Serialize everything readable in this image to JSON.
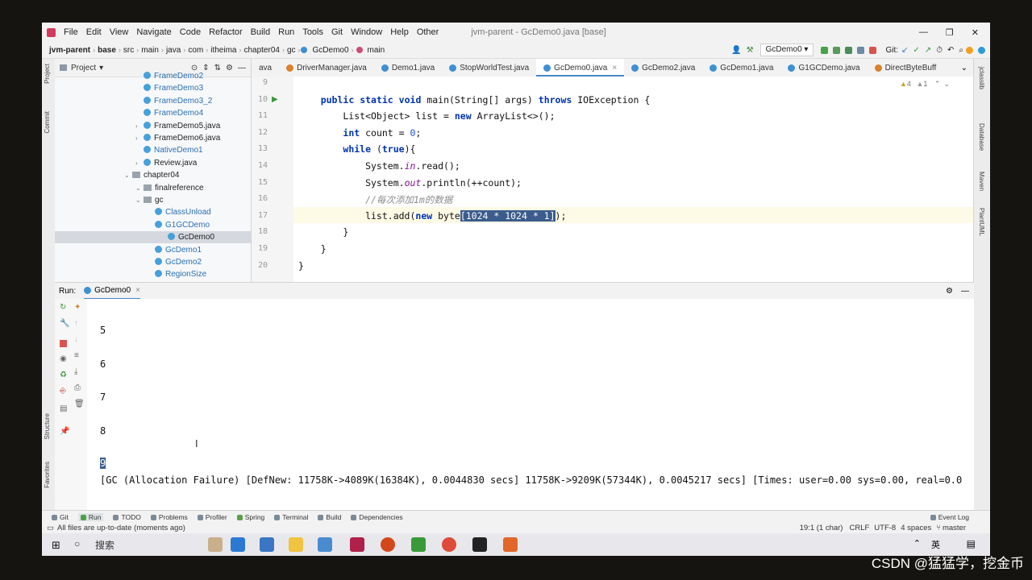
{
  "menu": {
    "items": [
      "File",
      "Edit",
      "View",
      "Navigate",
      "Code",
      "Refactor",
      "Build",
      "Run",
      "Tools",
      "Git",
      "Window",
      "Help",
      "Other"
    ],
    "title": "jvm-parent - GcDemo0.java [base]"
  },
  "breadcrumb": [
    "jvm-parent",
    "base",
    "src",
    "main",
    "java",
    "com",
    "itheima",
    "chapter04",
    "gc",
    "GcDemo0",
    "main"
  ],
  "toolbar": {
    "run_config": "GcDemo0",
    "git_label": "Git:"
  },
  "tabs": [
    "ava",
    "DriverManager.java",
    "Demo1.java",
    "StopWorldTest.java",
    "GcDemo0.java",
    "GcDemo2.java",
    "GcDemo1.java",
    "G1GCDemo.java",
    "DirectByteBuff"
  ],
  "active_tab": "GcDemo0.java",
  "inspections": {
    "warnings": "4",
    "weak": "1"
  },
  "project": {
    "label": "Project",
    "tree": [
      {
        "label": "FrameDemo2",
        "kind": "class",
        "indent": 0
      },
      {
        "label": "FrameDemo3",
        "kind": "class",
        "indent": 0
      },
      {
        "label": "FrameDemo3_2",
        "kind": "class",
        "indent": 0
      },
      {
        "label": "FrameDemo4",
        "kind": "class",
        "indent": 0
      },
      {
        "label": "FrameDemo5.java",
        "kind": "file",
        "indent": 0,
        "arrow": true
      },
      {
        "label": "FrameDemo6.java",
        "kind": "file",
        "indent": 0,
        "arrow": true
      },
      {
        "label": "NativeDemo1",
        "kind": "class",
        "indent": 0
      },
      {
        "label": "Review.java",
        "kind": "file",
        "indent": 0,
        "arrow": true
      },
      {
        "label": "chapter04",
        "kind": "folder",
        "indent": -1,
        "arrow": true
      },
      {
        "label": "finalreference",
        "kind": "folder",
        "indent": 0,
        "arrow": true
      },
      {
        "label": "gc",
        "kind": "folder",
        "indent": 0,
        "arrow": true
      },
      {
        "label": "ClassUnload",
        "kind": "class",
        "indent": 1
      },
      {
        "label": "G1GCDemo",
        "kind": "class",
        "indent": 1
      },
      {
        "label": "GcDemo0",
        "kind": "class",
        "indent": 1,
        "selected": true
      },
      {
        "label": "GcDemo1",
        "kind": "class",
        "indent": 1
      },
      {
        "label": "GcDemo2",
        "kind": "class",
        "indent": 1
      },
      {
        "label": "RegionSize",
        "kind": "class",
        "indent": 1
      }
    ]
  },
  "editor": {
    "line_numbers": [
      "9",
      "10",
      "11",
      "12",
      "13",
      "14",
      "15",
      "16",
      "17",
      "18",
      "19",
      "20"
    ],
    "lines": [
      "",
      "    public static void main(String[] args) throws IOException {",
      "        List<Object> list = new ArrayList<>();",
      "        int count = 0;",
      "        while (true){",
      "            System.in.read();",
      "            System.out.println(++count);",
      "            //每次添加1m的数据",
      "            list.add(new byte[1024 * 1024 * 1]);",
      "        }",
      "    }",
      "}"
    ]
  },
  "run": {
    "label": "Run:",
    "tab": "GcDemo0"
  },
  "console": {
    "lines": [
      "5",
      "6",
      "7",
      "8",
      "9",
      "[GC (Allocation Failure) [DefNew: 11758K->4089K(16384K), 0.0044830 secs] 11758K->9209K(57344K), 0.0045217 secs] [Times: user=0.00 sys=0.00, real=0.0"
    ]
  },
  "bottom_tabs": [
    "Git",
    "Run",
    "TODO",
    "Problems",
    "Profiler",
    "Spring",
    "Terminal",
    "Build",
    "Dependencies"
  ],
  "status": {
    "message": "All files are up-to-date (moments ago)",
    "position": "19:1 (1 char)",
    "line_sep": "CRLF",
    "encoding": "UTF-8",
    "indent": "4 spaces",
    "branch": "master",
    "event_log": "Event Log"
  },
  "side_labels": {
    "left": [
      "Project",
      "Commit",
      "Structure",
      "Favorites"
    ],
    "right": [
      "jclasslib",
      "Database",
      "Maven",
      "PlantUML"
    ]
  },
  "taskbar": {
    "search_placeholder": "搜索"
  },
  "watermark": "CSDN @猛猛学，挖金币",
  "colors": {
    "keyword": "#0033b3",
    "selection": "#3b5c8c",
    "tab_underline": "#4a86c8"
  }
}
